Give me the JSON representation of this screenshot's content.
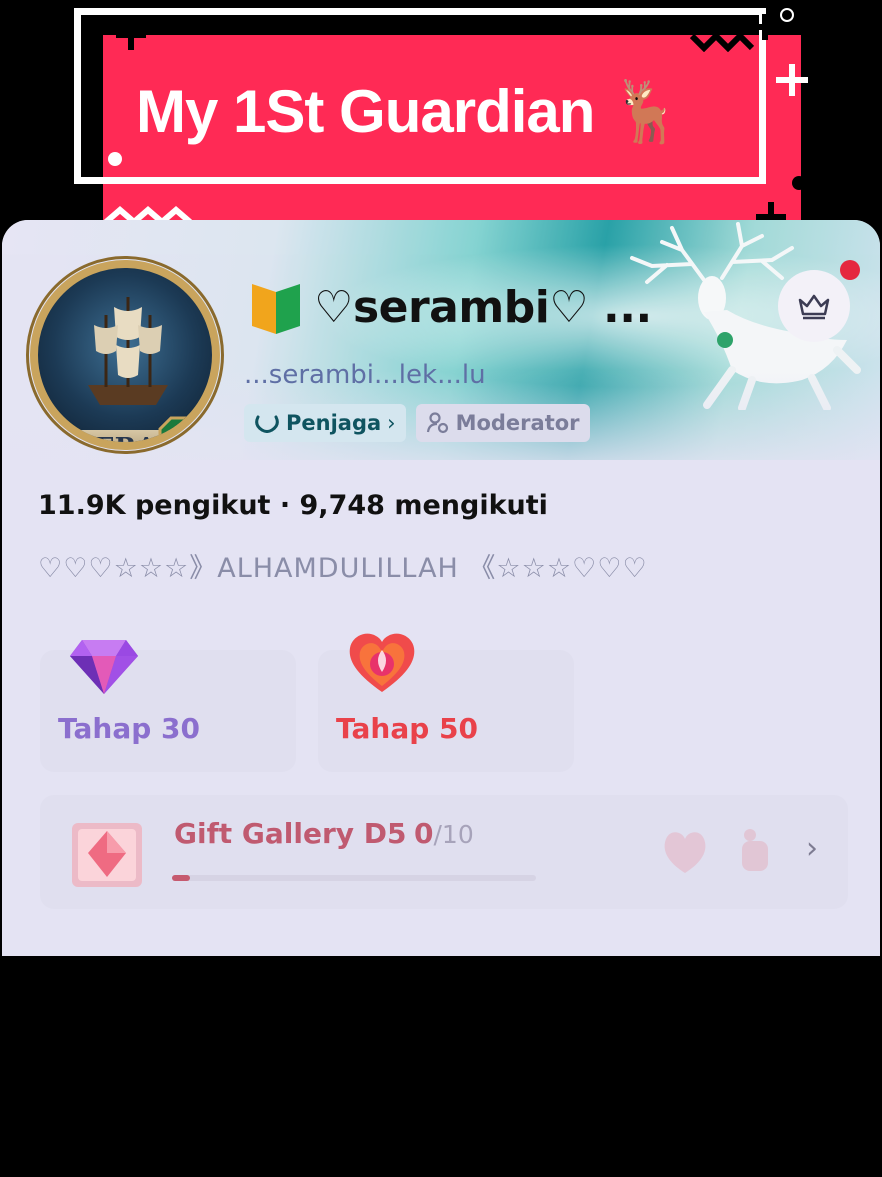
{
  "banner": {
    "title": "My 1St Guardian 🦌",
    "colors": {
      "background": "#ff2a55",
      "frame": "#ffffff"
    }
  },
  "profile": {
    "avatar_text": "SERAN",
    "username": "♡serambi♡ ...",
    "handle": "...serambi...lek...lu",
    "badges": [
      {
        "icon": "guardian-icon",
        "label": "Penjaga",
        "chevron": "›"
      },
      {
        "icon": "moderator-icon",
        "label": "Moderator"
      }
    ],
    "stats": "11.9K pengikut · 9,748 mengikuti",
    "bio": "♡♡♡☆☆☆》ALHAMDULILLAH 《☆☆☆♡♡♡",
    "crown_button_icon": "crown-icon"
  },
  "levels": [
    {
      "icon": "diamond-icon",
      "label": "Tahap 30",
      "color": "#8b6fce"
    },
    {
      "icon": "heart-icon",
      "label": "Tahap 50",
      "color": "#e9424a"
    }
  ],
  "gift_gallery": {
    "title": "Gift Gallery D5",
    "count": "0",
    "total": "/10",
    "progress": 0.05,
    "chevron": "›"
  }
}
